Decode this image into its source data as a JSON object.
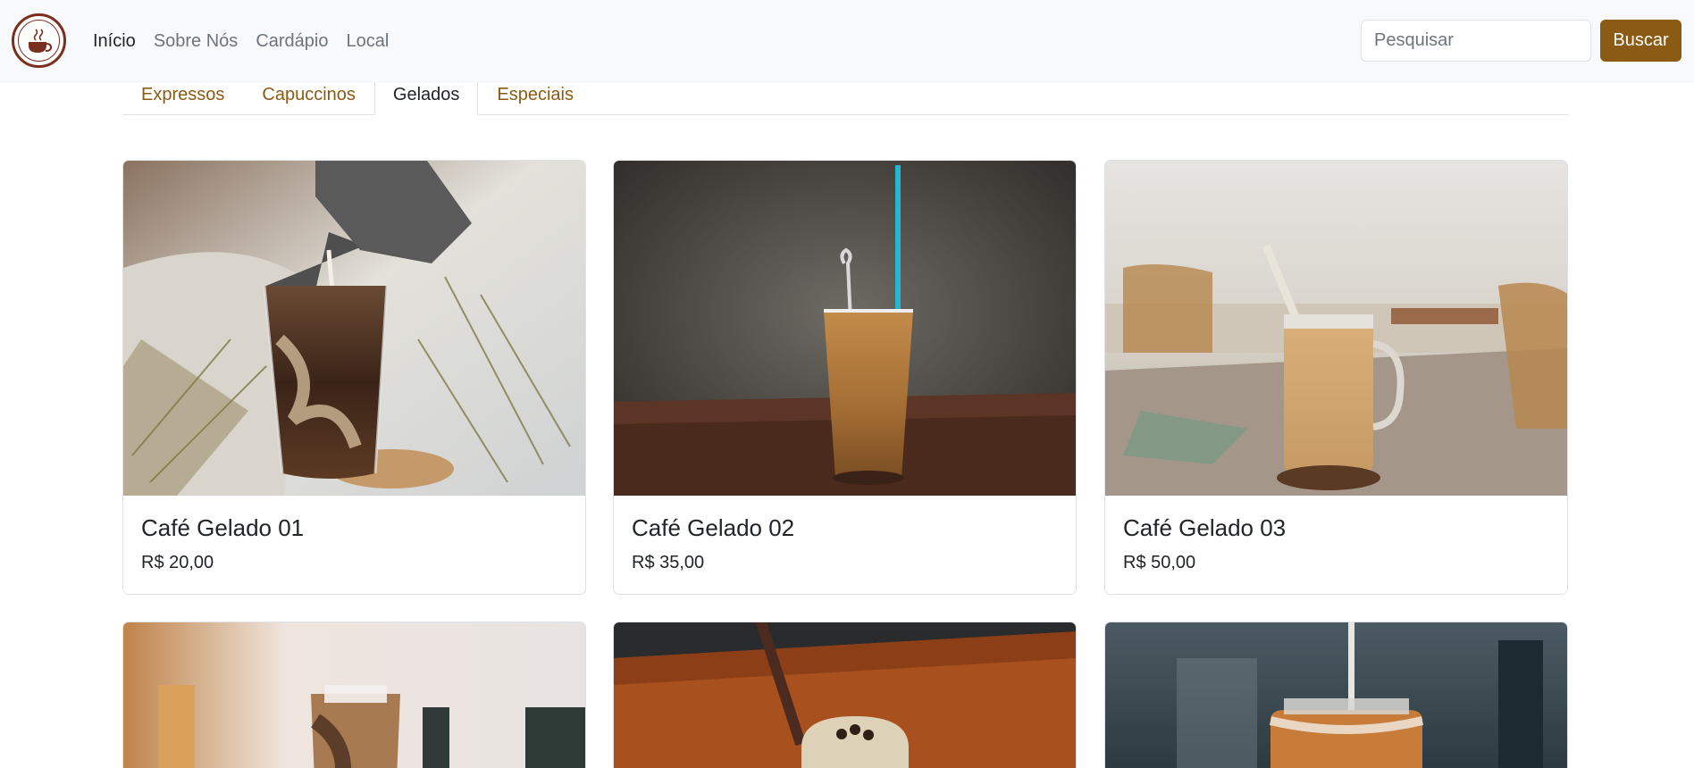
{
  "navbar": {
    "links": [
      {
        "label": "Início",
        "active": true
      },
      {
        "label": "Sobre Nós",
        "active": false
      },
      {
        "label": "Cardápio",
        "active": false
      },
      {
        "label": "Local",
        "active": false
      }
    ],
    "search_placeholder": "Pesquisar",
    "search_button": "Buscar",
    "logo_icon": "coffee-cup-icon"
  },
  "tabs": [
    {
      "label": "Expressos",
      "active": false
    },
    {
      "label": "Capuccinos",
      "active": false
    },
    {
      "label": "Gelados",
      "active": true
    },
    {
      "label": "Especiais",
      "active": false
    }
  ],
  "products": [
    {
      "name": "Café Gelado 01",
      "price": "R$ 20,00"
    },
    {
      "name": "Café Gelado 02",
      "price": "R$ 35,00"
    },
    {
      "name": "Café Gelado 03",
      "price": "R$ 50,00"
    }
  ],
  "colors": {
    "brand": "#8b5a13",
    "navbar_bg": "#f8f9fa",
    "logo_ring": "#7a2e1c"
  }
}
